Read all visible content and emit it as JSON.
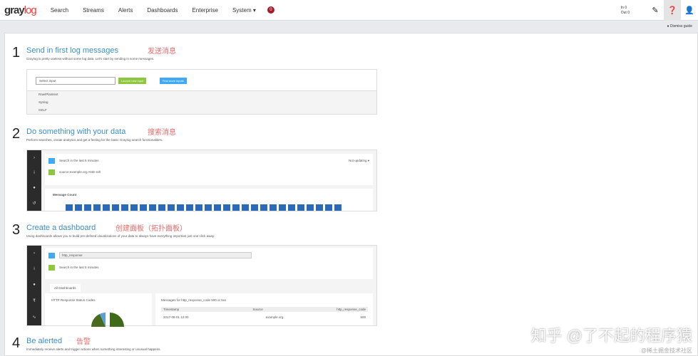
{
  "nav": {
    "logo_main": "gray",
    "logo_accent": "log",
    "items": [
      "Search",
      "Streams",
      "Alerts",
      "Dashboards",
      "Enterprise",
      "System ▾"
    ],
    "notification_count": "0"
  },
  "header_right": {
    "throughput_in": "In 0",
    "throughput_out": "Out 0",
    "edit_icon": "edit-icon",
    "help_icon": "help-icon",
    "user_icon": "user-icon"
  },
  "dismiss": "● Dismiss guide",
  "steps": [
    {
      "num": "1",
      "title": "Send in first log messages",
      "note": "发送消息",
      "desc": "Graylog is pretty useless without some log data. Let's start by sending in some messages."
    },
    {
      "num": "2",
      "title": "Do something with your data",
      "note": "搜索消息",
      "desc": "Perform searches, create analytics and get a feeling for the basic Graylog search functionalities."
    },
    {
      "num": "3",
      "title": "Create a dashboard",
      "note": "创建面板（拓扑面板）",
      "desc": "Using dashboards allows you to build pre-defined visualizations of your data to always have everything important just one click away."
    },
    {
      "num": "4",
      "title": "Be alerted",
      "note": "告警",
      "desc": "Immediately receive alerts and trigger actions when something interesting or unusual happens."
    }
  ],
  "shot1": {
    "select": "Select input",
    "launch": "Launch new input",
    "find": "Find more inputs",
    "options": [
      "Raw/Plaintext",
      "Syslog",
      "GELF"
    ]
  },
  "shot2": {
    "query": "source:example.org AND ssh",
    "widget": "Message Count",
    "range": "Search in the last 5 minutes",
    "save": "Not updating ▾"
  },
  "shot3": {
    "query": "http_response",
    "tab": "All Dashboards",
    "widget1": "HTTP Response Status Codes",
    "widget2": "Messages for http_response_code 500 or 5xx",
    "cols": [
      "Timestamp",
      "Source",
      "http_response_code"
    ],
    "row": [
      "2017-08-01 12:00",
      "example.org",
      "500"
    ]
  },
  "watermark": "知乎 @了不起的程序猿",
  "watermark2": "@稀土掘金技术社区"
}
